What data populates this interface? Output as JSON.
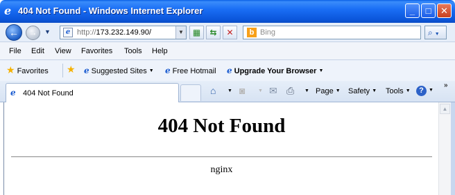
{
  "window": {
    "title": "404 Not Found - Windows Internet Explorer",
    "minimize_glyph": "_",
    "maximize_glyph": "□",
    "close_glyph": "✕"
  },
  "address_bar": {
    "protocol": "http://",
    "host": "173.232.149.90/",
    "search_placeholder": "Bing",
    "back_glyph": "←",
    "forward_glyph": "→"
  },
  "menu": {
    "items": [
      "File",
      "Edit",
      "View",
      "Favorites",
      "Tools",
      "Help"
    ]
  },
  "favorites_bar": {
    "favorites_label": "Favorites",
    "links": [
      "Suggested Sites",
      "Free Hotmail",
      "Upgrade Your Browser"
    ]
  },
  "tabs": {
    "active_label": "404 Not Found"
  },
  "command_bar": {
    "page_label": "Page",
    "safety_label": "Safety",
    "tools_label": "Tools",
    "help_glyph": "?",
    "more_glyph": "»"
  },
  "page": {
    "heading": "404 Not Found",
    "server": "nginx"
  },
  "icons": {
    "ie": "internet-explorer-icon",
    "star": "favorites-star-icon",
    "home": "home-icon",
    "feeds": "rss-feed-icon",
    "mail": "mail-icon",
    "print": "printer-icon"
  },
  "colors": {
    "titlebar": "#1a6ef5",
    "accent": "#2d62c8"
  }
}
